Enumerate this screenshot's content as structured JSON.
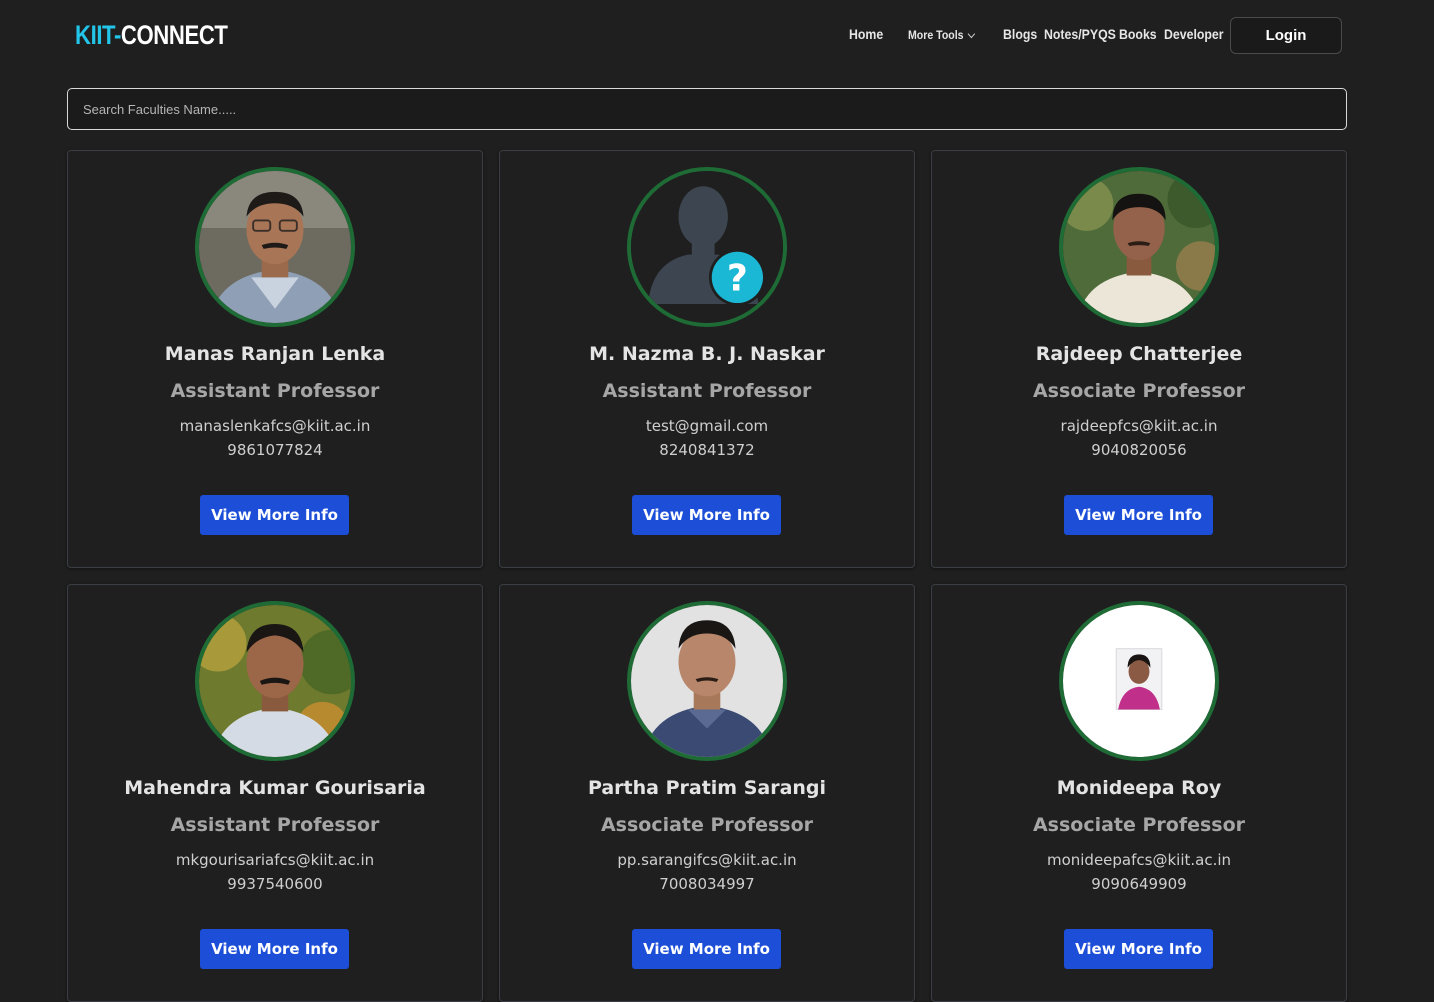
{
  "brand": {
    "part1": "KIIT-",
    "part2": "CONNECT"
  },
  "nav": {
    "home": "Home",
    "more_tools": "More Tools",
    "blogs": "Blogs",
    "notes": "Notes/PYQS",
    "books": "Books",
    "developer": "Developer",
    "login": "Login"
  },
  "search": {
    "placeholder": "Search Faculties Name.....",
    "value": ""
  },
  "colors": {
    "accent": "#22c5e8",
    "button": "#1c4ed8",
    "avatar_ring": "#1e6b35",
    "background": "#1f1f1f"
  },
  "faculty": [
    {
      "name": "Manas Ranjan Lenka",
      "role": "Assistant Professor",
      "email": "manaslenkafcs@kiit.ac.in",
      "phone": "9861077824",
      "button": "View More Info",
      "photo": "photo"
    },
    {
      "name": "M. Nazma B. J. Naskar",
      "role": "Assistant Professor",
      "email": "test@gmail.com",
      "phone": "8240841372",
      "button": "View More Info",
      "photo": "unknown-user-icon"
    },
    {
      "name": "Rajdeep Chatterjee",
      "role": "Associate Professor",
      "email": "rajdeepfcs@kiit.ac.in",
      "phone": "9040820056",
      "button": "View More Info",
      "photo": "photo"
    },
    {
      "name": "Mahendra Kumar Gourisaria",
      "role": "Assistant Professor",
      "email": "mkgourisariafcs@kiit.ac.in",
      "phone": "9937540600",
      "button": "View More Info",
      "photo": "photo"
    },
    {
      "name": "Partha Pratim Sarangi",
      "role": "Associate Professor",
      "email": "pp.sarangifcs@kiit.ac.in",
      "phone": "7008034997",
      "button": "View More Info",
      "photo": "photo"
    },
    {
      "name": "Monideepa Roy",
      "role": "Associate Professor",
      "email": "monideepafcs@kiit.ac.in",
      "phone": "9090649909",
      "button": "View More Info",
      "photo": "photo"
    }
  ]
}
